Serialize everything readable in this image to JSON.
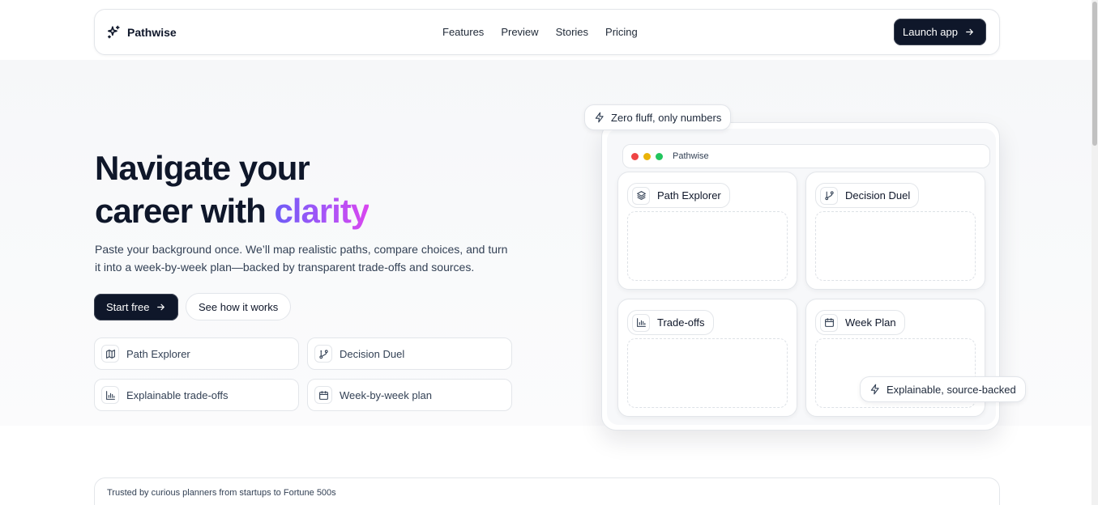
{
  "nav": {
    "brand": "Pathwise",
    "links": [
      "Features",
      "Preview",
      "Stories",
      "Pricing"
    ],
    "cta": "Launch app"
  },
  "hero": {
    "headline_line1": "Navigate your",
    "headline_line2_prefix": "career with ",
    "headline_accent": "clarity",
    "subtitle_line1": "Paste your background once. We’ll map realistic paths, compare choices, and turn",
    "subtitle_line2": "it into a week-by-week plan—backed by transparent trade-offs and sources.",
    "primary_cta": "Start free",
    "secondary_cta": "See how it works",
    "features": [
      {
        "label": "Path Explorer",
        "icon": "map-icon"
      },
      {
        "label": "Decision Duel",
        "icon": "git-branch-icon"
      },
      {
        "label": "Explainable trade-offs",
        "icon": "bar-chart-icon"
      },
      {
        "label": "Week-by-week plan",
        "icon": "calendar-icon"
      }
    ]
  },
  "preview": {
    "chip_top": "Zero fluff, only numbers",
    "chip_bottom": "Explainable, source-backed",
    "window_title": "Pathwise",
    "window_dots": [
      "#ef4444",
      "#eab308",
      "#22c55e"
    ],
    "cards": [
      {
        "label": "Path Explorer",
        "icon": "layers-icon"
      },
      {
        "label": "Decision Duel",
        "icon": "git-branch-icon"
      },
      {
        "label": "Trade-offs",
        "icon": "bar-chart-icon"
      },
      {
        "label": "Week Plan",
        "icon": "calendar-icon"
      }
    ]
  },
  "trusted": {
    "text": "Trusted by curious planners from startups to Fortune 500s"
  },
  "colors": {
    "primary": "#0f172a",
    "accent_gradient_start": "#6d5cf6",
    "accent_gradient_end": "#d946ef"
  }
}
